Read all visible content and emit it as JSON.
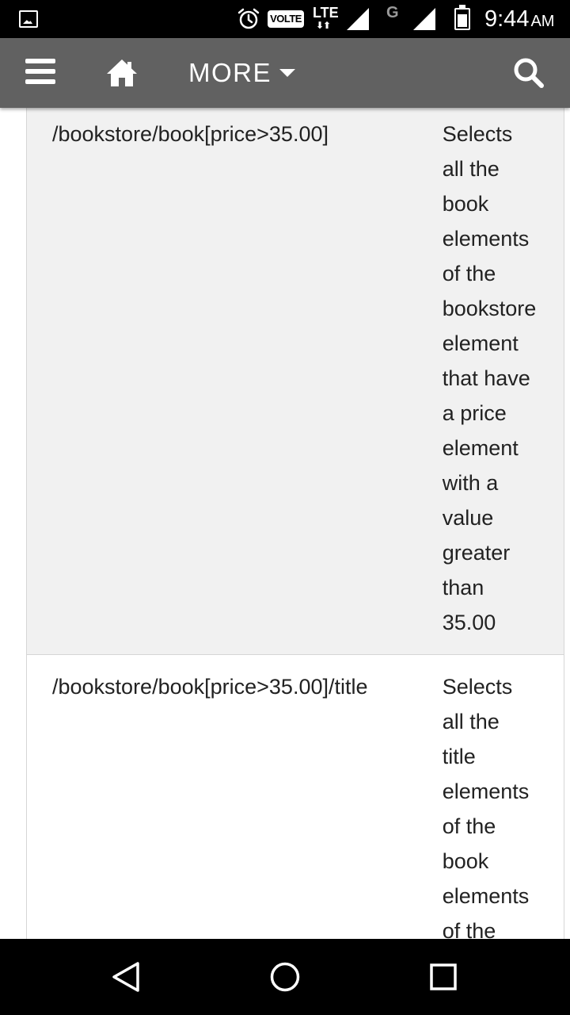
{
  "status_bar": {
    "volte_label": "VOLTE",
    "lte_label": "LTE",
    "lte_arrows": "⬇⬆",
    "network_g_label": "G",
    "time": "9:44",
    "ampm": "AM",
    "icons": [
      "gallery-notification-icon",
      "alarm-icon",
      "signal-icon",
      "battery-icon"
    ]
  },
  "app_bar": {
    "more_label": "MORE",
    "background": "#616161",
    "icons": [
      "menu-icon",
      "home-icon",
      "caret-down-icon",
      "search-icon"
    ]
  },
  "table": {
    "rows": [
      {
        "expression": "/bookstore/book[price>35.00]",
        "description_lines": [
          "Selects",
          "all the",
          "book",
          "elements",
          "of the",
          "bookstore",
          "element",
          "that have",
          "a price",
          "element",
          "with a",
          "value",
          "greater",
          "than",
          "35.00"
        ]
      },
      {
        "expression": "/bookstore/book[price>35.00]/title",
        "description_lines": [
          "Selects",
          "all the",
          "title",
          "elements",
          "of the",
          "book",
          "elements",
          "of the"
        ]
      }
    ]
  },
  "nav_bar": {
    "icons": [
      "back-icon",
      "home-circle-icon",
      "recents-icon"
    ]
  }
}
